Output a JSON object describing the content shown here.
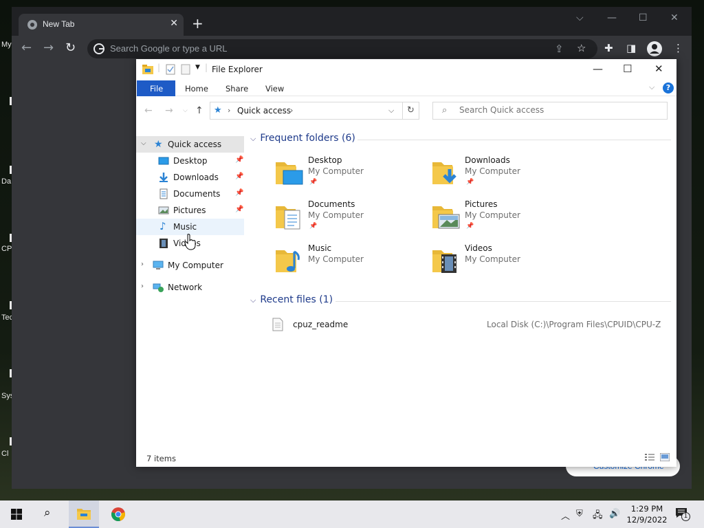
{
  "desktop": {
    "labels": [
      "My",
      "Da",
      "CP",
      "Tec",
      "Sys",
      "Cl",
      "l"
    ]
  },
  "chrome": {
    "tab_title": "New Tab",
    "tab_close": "✕",
    "new_tab": "+",
    "omnibox_placeholder": "Search Google or type a URL",
    "customize_label": "Customize Chrome"
  },
  "explorer": {
    "title": "File Explorer",
    "ribbon": {
      "file": "File",
      "home": "Home",
      "share": "Share",
      "view": "View",
      "help": "?"
    },
    "address": {
      "location": "Quick access"
    },
    "search_placeholder": "Search Quick access",
    "nav": {
      "quick_access": "Quick access",
      "items": [
        {
          "label": "Desktop",
          "pinned": true
        },
        {
          "label": "Downloads",
          "pinned": true
        },
        {
          "label": "Documents",
          "pinned": true
        },
        {
          "label": "Pictures",
          "pinned": true
        },
        {
          "label": "Music",
          "pinned": false
        },
        {
          "label": "Videos",
          "pinned": false
        }
      ],
      "my_computer": "My Computer",
      "network": "Network"
    },
    "frequent": {
      "header": "Frequent folders (6)",
      "folders": [
        {
          "name": "Desktop",
          "location": "My Computer",
          "pinned": true
        },
        {
          "name": "Downloads",
          "location": "My Computer",
          "pinned": true
        },
        {
          "name": "Documents",
          "location": "My Computer",
          "pinned": true
        },
        {
          "name": "Pictures",
          "location": "My Computer",
          "pinned": true
        },
        {
          "name": "Music",
          "location": "My Computer",
          "pinned": false
        },
        {
          "name": "Videos",
          "location": "My Computer",
          "pinned": false
        }
      ]
    },
    "recent": {
      "header": "Recent files (1)",
      "files": [
        {
          "name": "cpuz_readme",
          "path": "Local Disk (C:)\\Program Files\\CPUID\\CPU-Z"
        }
      ]
    },
    "status": {
      "item_count": "7 items"
    }
  },
  "taskbar": {
    "time": "1:29 PM",
    "date": "12/9/2022",
    "notification_count": "1"
  },
  "colors": {
    "accent": "#1e5bc6",
    "folder": "#f4c84a",
    "section_header": "#1e3a8a"
  }
}
